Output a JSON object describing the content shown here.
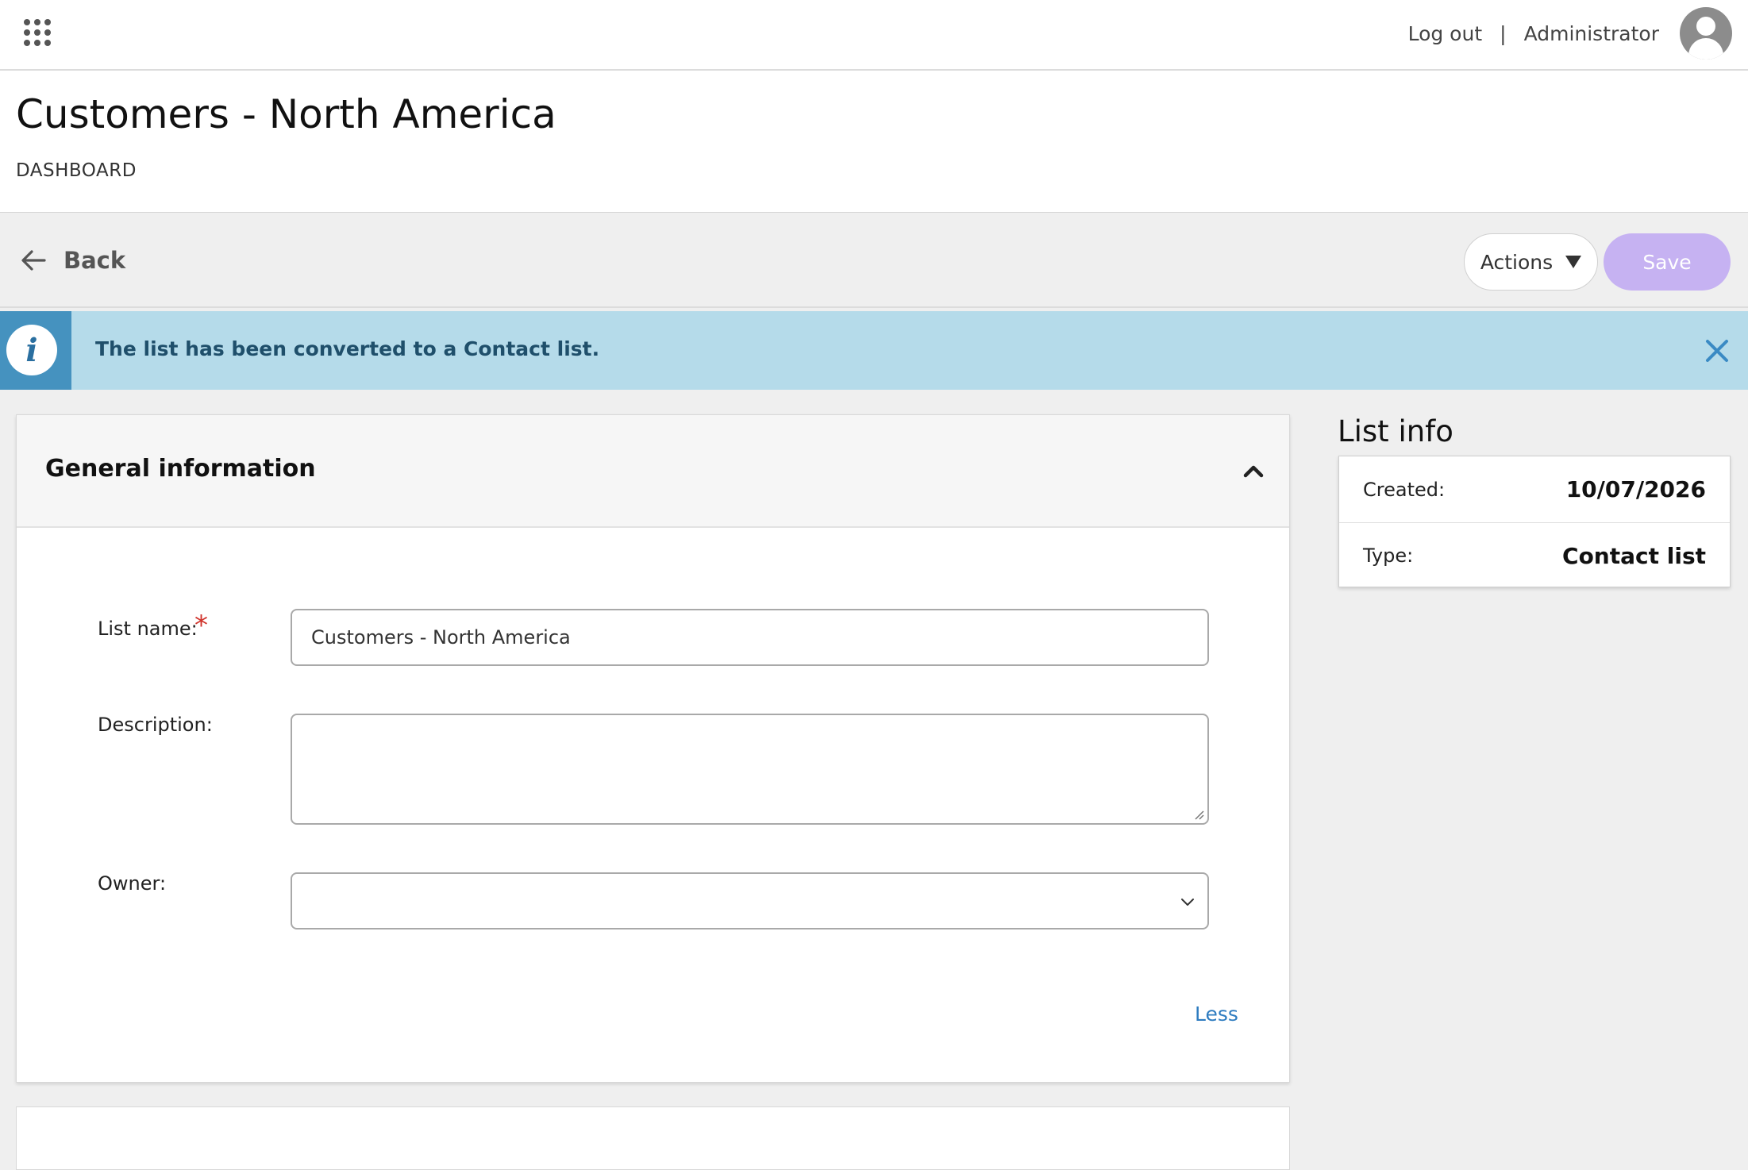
{
  "topbar": {
    "apps_icon": "grid-apps-icon",
    "logout_label": "Log out",
    "separator": "|",
    "user_name": "Administrator",
    "avatar_icon": "user-avatar-icon"
  },
  "header": {
    "title": "Customers - North America",
    "subtitle": "DASHBOARD"
  },
  "toolbar": {
    "back_label": "Back",
    "back_icon": "arrow-left-icon",
    "actions_label": "Actions",
    "save_label": "Save"
  },
  "banner": {
    "icon": "info-icon",
    "message": "The list has been converted to a Contact list.",
    "close_icon": "close-icon"
  },
  "general": {
    "title": "General information",
    "collapse_icon": "chevron-up-icon",
    "list_name_label": "List name:",
    "required_marker": "*",
    "list_name_value": "Customers - North America",
    "description_label": "Description:",
    "description_value": "",
    "owner_label": "Owner:",
    "owner_value": "",
    "less_label": "Less"
  },
  "list_info": {
    "title": "List info",
    "created_label": "Created:",
    "created_value": "10/07/2026",
    "type_label": "Type:",
    "type_value": "Contact list"
  },
  "colors": {
    "accent_save": "#c6b2f2",
    "banner_bg": "#b5dbea",
    "banner_icon_bg": "#4592bf",
    "link": "#2e7cc0",
    "required": "#d0342c"
  }
}
